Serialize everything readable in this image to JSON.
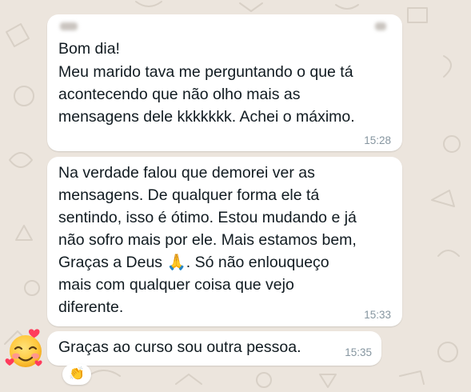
{
  "messages": [
    {
      "lines": [
        "Bom dia!",
        "Meu marido tava me perguntando o que tá",
        "acontecendo que não olho mais as",
        "mensagens dele kkkkkkk. Achei o máximo."
      ],
      "time": "15:28"
    },
    {
      "lines": [
        "Na verdade falou que demorei ver as",
        "mensagens. De qualquer forma ele tá",
        "sentindo, isso é ótimo. Estou mudando e já",
        "não sofro mais por ele. Mais estamos bem,",
        "Graças a Deus 🙏. Só não enlouqueço",
        "mais com qualquer coisa que vejo",
        "diferente."
      ],
      "time": "15:33"
    },
    {
      "lines": [
        "Graças ao curso sou outra pessoa."
      ],
      "time": "15:35",
      "reaction": "👏"
    }
  ],
  "colors": {
    "wallpaper": "#ece5dd",
    "bubble": "#ffffff",
    "timestamp": "#8696a0",
    "text": "#111b21"
  },
  "icons": [
    "smiling-face-with-hearts-icon",
    "clapping-hands-icon",
    "folded-hands-icon"
  ]
}
